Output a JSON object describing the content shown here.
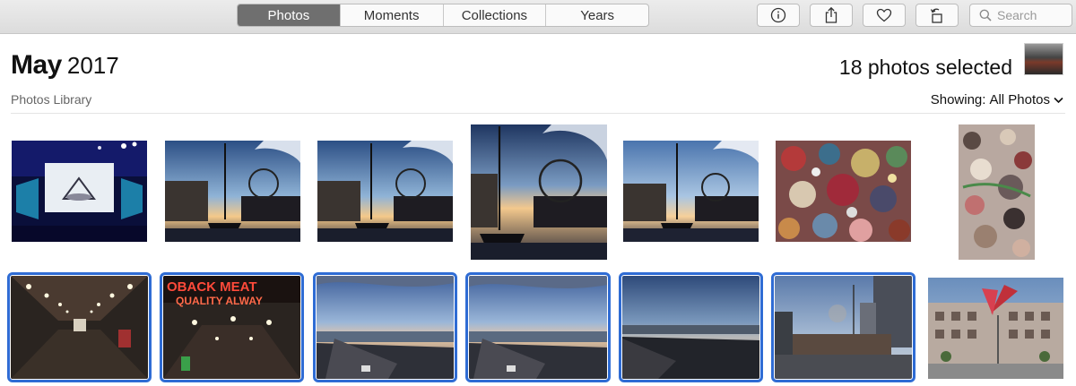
{
  "toolbar": {
    "tabs": [
      {
        "label": "Photos",
        "active": true
      },
      {
        "label": "Moments",
        "active": false
      },
      {
        "label": "Collections",
        "active": false
      },
      {
        "label": "Years",
        "active": false
      }
    ],
    "buttons": [
      {
        "icon": "info-icon"
      },
      {
        "icon": "share-icon"
      },
      {
        "icon": "heart-icon"
      },
      {
        "icon": "rotate-icon"
      }
    ],
    "search": {
      "placeholder": "Search",
      "icon": "search-icon"
    }
  },
  "header": {
    "month": "May",
    "year": "2017",
    "subtitle": "Photos Library",
    "selected_text": "18 photos selected",
    "showing_label": "Showing:",
    "showing_value": "All Photos"
  },
  "colors": {
    "selection": "#2f6cd4",
    "active_tab": "#6f6f6f"
  },
  "photos": [
    {
      "subject": "stage with screens and blue lights",
      "selected": false
    },
    {
      "subject": "pier with sailboat and ferris wheel",
      "selected": false
    },
    {
      "subject": "pier with sailboat and ferris wheel",
      "selected": false
    },
    {
      "subject": "pier with sailboat and ferris wheel at sunset",
      "selected": false
    },
    {
      "subject": "pier with sailboat and ferris wheel",
      "selected": false
    },
    {
      "subject": "gum wall",
      "selected": false
    },
    {
      "subject": "gum wall",
      "selected": false
    },
    {
      "subject": "market hallway",
      "selected": true
    },
    {
      "subject": "market sign",
      "selected": true
    },
    {
      "subject": "waterfront view",
      "selected": true
    },
    {
      "subject": "waterfront view",
      "selected": true
    },
    {
      "subject": "waterfront view",
      "selected": true
    },
    {
      "subject": "city street",
      "selected": true
    },
    {
      "subject": "street sculpture",
      "selected": false
    }
  ]
}
